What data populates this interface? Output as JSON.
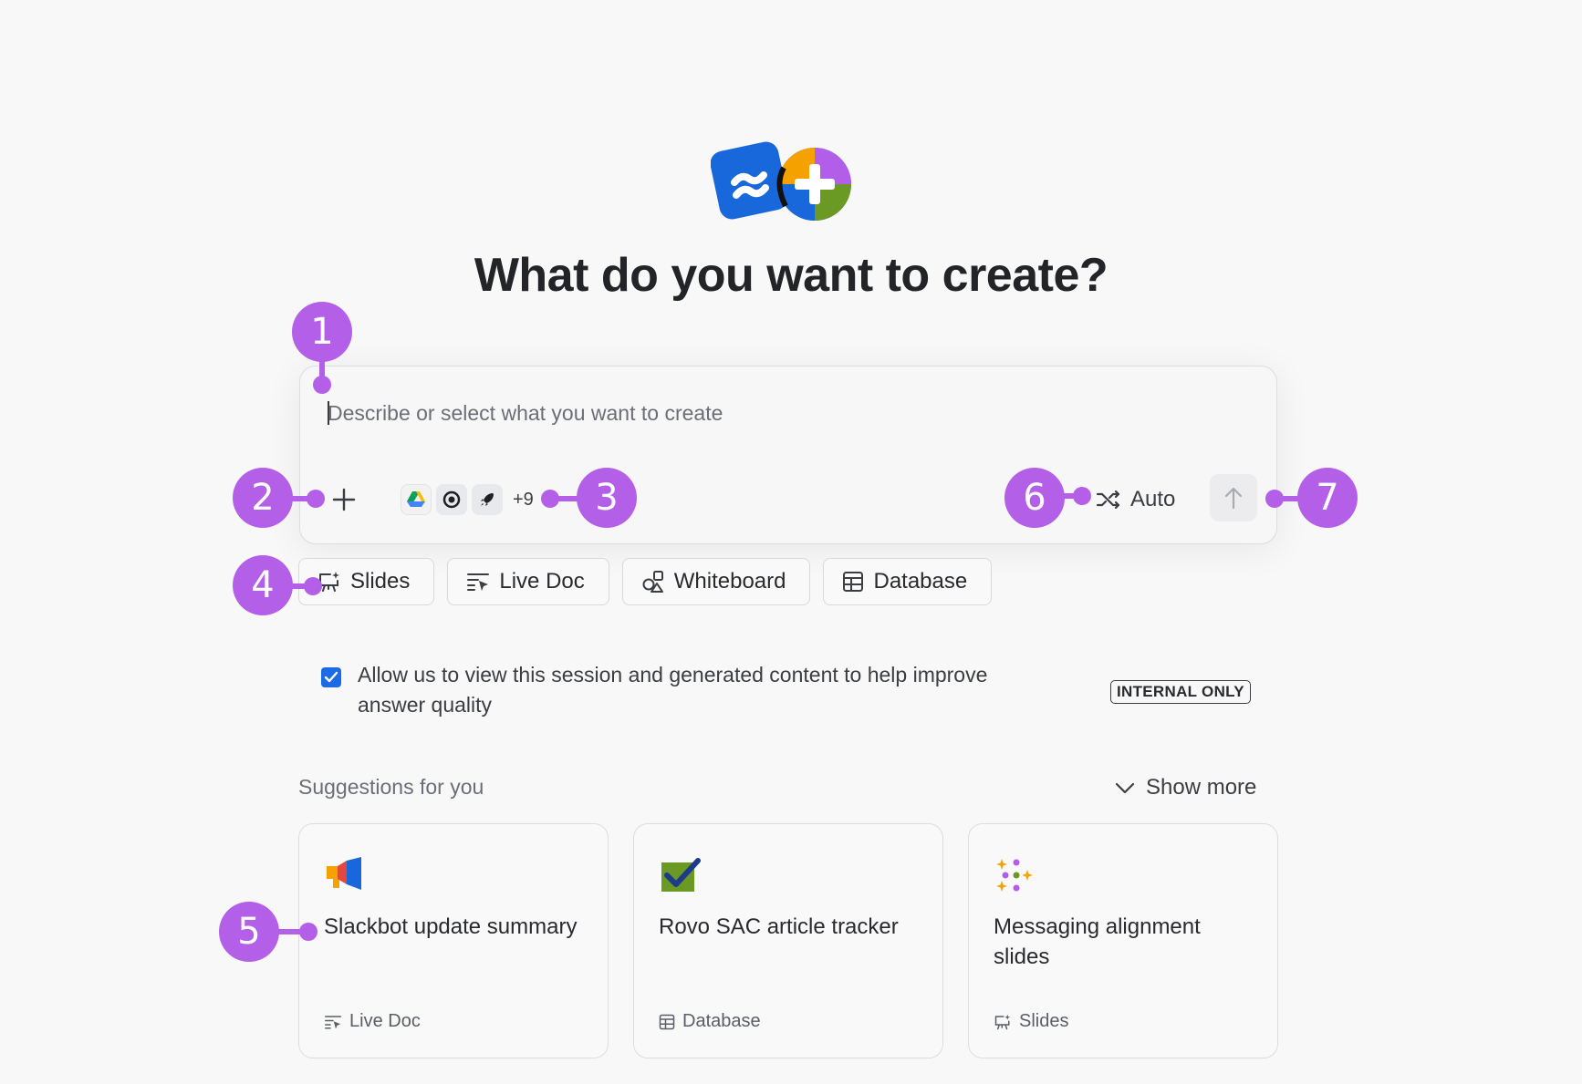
{
  "page_title": "What do you want to create?",
  "composer": {
    "placeholder": "Describe or select what you want to create",
    "sources_more": "+9",
    "mode_label": "Auto"
  },
  "chips": [
    {
      "label": "Slides",
      "icon": "slides-icon"
    },
    {
      "label": "Live Doc",
      "icon": "live-doc-icon"
    },
    {
      "label": "Whiteboard",
      "icon": "whiteboard-icon"
    },
    {
      "label": "Database",
      "icon": "database-icon"
    }
  ],
  "consent": {
    "text": "Allow us to view this session and generated content to help improve answer quality",
    "checked": true,
    "badge": "INTERNAL ONLY"
  },
  "suggestions": {
    "title": "Suggestions for you",
    "show_more": "Show more",
    "cards": [
      {
        "title": "Slackbot update summary",
        "type": "Live Doc",
        "icon": "megaphone-icon"
      },
      {
        "title": "Rovo SAC article tracker",
        "type": "Database",
        "icon": "checkmark-icon"
      },
      {
        "title": "Messaging alignment slides",
        "type": "Slides",
        "icon": "sparkles-icon"
      }
    ]
  },
  "markers": [
    "1",
    "2",
    "3",
    "4",
    "5",
    "6",
    "7"
  ],
  "colors": {
    "accent": "#1d6ae5",
    "marker": "#b45fe8"
  }
}
